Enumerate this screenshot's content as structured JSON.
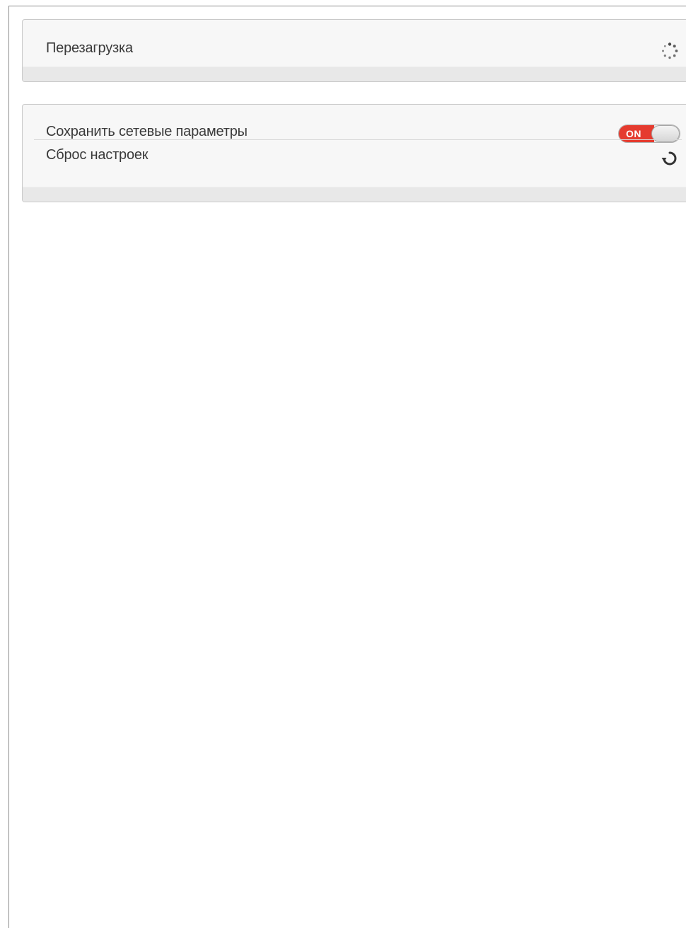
{
  "reboot_panel": {
    "label": "Перезагрузка",
    "icon": "spinner-icon"
  },
  "settings_panel": {
    "save_network": {
      "label": "Сохранить сетевые параметры",
      "toggle_text": "ON",
      "state": "on",
      "accent_color": "#e53b2f"
    },
    "reset": {
      "label": "Сброс настроек",
      "icon": "reset-icon"
    }
  }
}
